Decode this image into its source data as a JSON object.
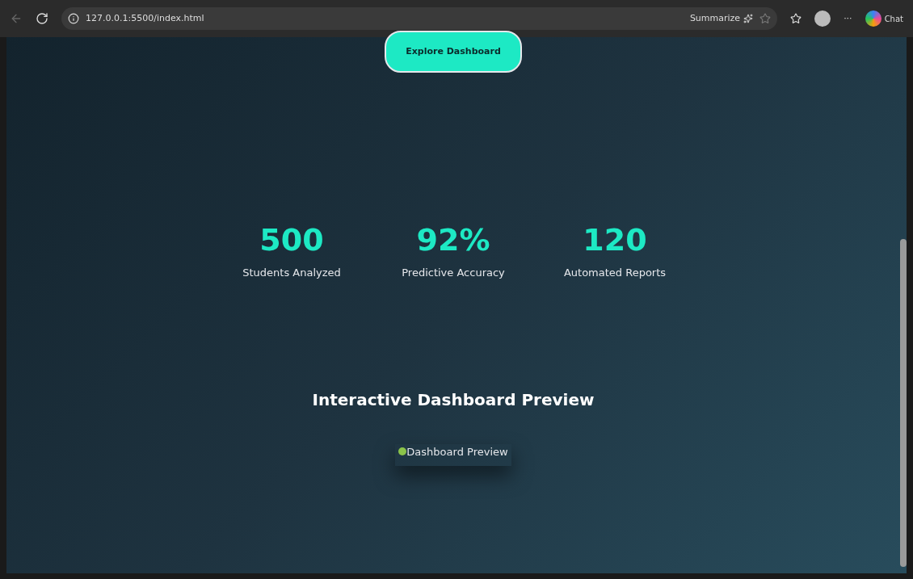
{
  "browser": {
    "url": "127.0.0.1:5500/index.html",
    "summarize": "Summarize",
    "more": "···",
    "chat": "Chat"
  },
  "hero": {
    "button": "Explore Dashboard"
  },
  "stats": [
    {
      "value": "500",
      "label": "Students Analyzed"
    },
    {
      "value": "92%",
      "label": "Predictive Accuracy"
    },
    {
      "value": "120",
      "label": "Automated Reports"
    }
  ],
  "preview": {
    "title": "Interactive Dashboard Preview",
    "image_alt": "Dashboard Preview"
  }
}
